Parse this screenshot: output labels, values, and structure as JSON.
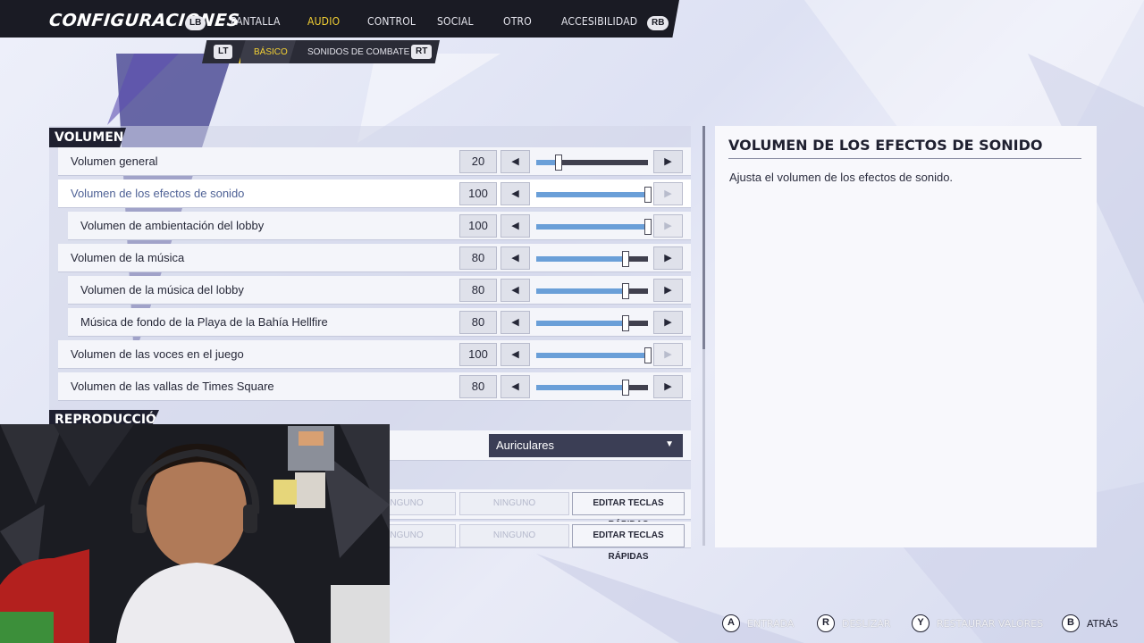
{
  "header": {
    "title": "CONFIGURACIONES",
    "lb": "LB",
    "rb": "RB",
    "tabs": [
      "PANTALLA",
      "AUDIO",
      "CONTROL",
      "SOCIAL",
      "OTRO",
      "ACCESIBILIDAD"
    ],
    "active_tab": "AUDIO"
  },
  "subnav": {
    "lt": "LT",
    "rt": "RT",
    "tabs": [
      "BÁSICO",
      "SONIDOS DE COMBATE"
    ],
    "active": "BÁSICO"
  },
  "sections": {
    "volume": "VOLUMEN",
    "playback": "REPRODUCCIÓN"
  },
  "volume_rows": [
    {
      "label": "Volumen general",
      "value": "20",
      "level": 20
    },
    {
      "label": "Volumen de los efectos de sonido",
      "value": "100",
      "level": 100
    },
    {
      "label": "Volumen de ambientación del lobby",
      "value": "100",
      "level": 100
    },
    {
      "label": "Volumen de la música",
      "value": "80",
      "level": 80
    },
    {
      "label": "Volumen de la música del lobby",
      "value": "80",
      "level": 80
    },
    {
      "label": "Música de fondo de la Playa de la Bahía Hellfire",
      "value": "80",
      "level": 80
    },
    {
      "label": "Volumen de las voces en el juego",
      "value": "100",
      "level": 100
    },
    {
      "label": "Volumen de las vallas de Times Square",
      "value": "80",
      "level": 80
    }
  ],
  "playback": {
    "output_device": "Auriculares"
  },
  "hotkeys": {
    "none_label": "NINGUNO",
    "edit_label": "EDITAR TECLAS RÁPIDAS"
  },
  "description": {
    "title": "VOLUMEN DE LOS EFECTOS DE SONIDO",
    "text": "Ajusta el volumen de los efectos de sonido."
  },
  "footer": {
    "hints": [
      {
        "key": "A",
        "label": "ENTRADA"
      },
      {
        "key": "R",
        "label": "DESLIZAR"
      },
      {
        "key": "Y",
        "label": "RESTAURAR VALORES"
      },
      {
        "key": "B",
        "label": "ATRÁS"
      }
    ]
  },
  "colors": {
    "accent": "#f5d234",
    "slider_fill": "#6a9fd8",
    "bar_dark": "#1a1b24"
  }
}
